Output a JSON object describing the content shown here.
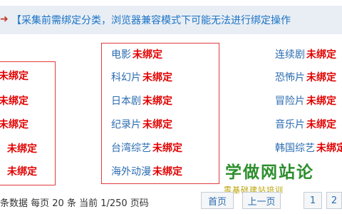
{
  "notice": {
    "arrow": "➜",
    "text": "【采集前需绑定分类，浏览器兼容模式下可能无法进行绑定操作"
  },
  "status_text": "未绑定",
  "col1": {
    "cats": [
      "",
      "",
      "",
      "",
      ""
    ]
  },
  "col2": {
    "cats": [
      "电影",
      "科幻片",
      "日本剧",
      "纪录片",
      "台湾综艺",
      "海外动漫"
    ]
  },
  "col3": {
    "cats": [
      "连续剧",
      "恐怖片",
      "冒险片",
      "音乐片",
      "韩国综艺"
    ]
  },
  "watermark": {
    "line1": "学做网站论",
    "line2": "零基础建站培训"
  },
  "pagination": {
    "info": "条数据 每页 20 条 当前 1/250 页码",
    "first": "首页",
    "prev": "上一页",
    "p1": "1",
    "p2": "2"
  }
}
